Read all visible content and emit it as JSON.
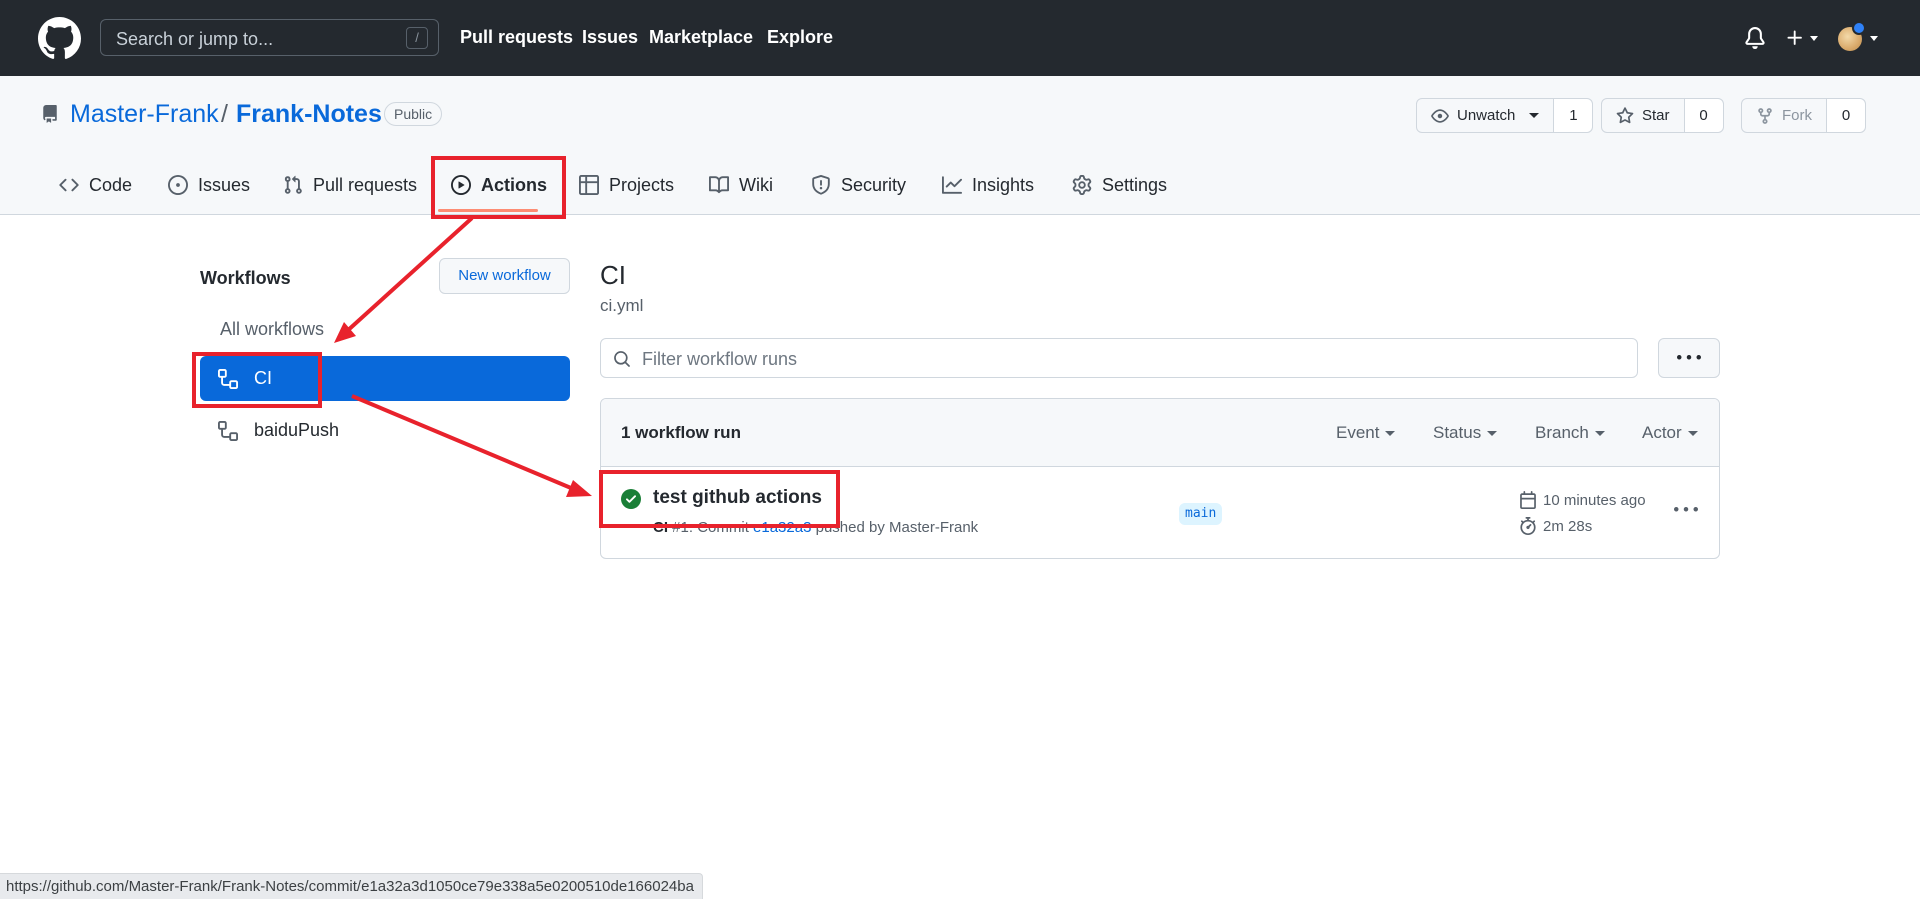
{
  "header": {
    "search_placeholder": "Search or jump to...",
    "search_shortcut": "/",
    "nav": [
      "Pull requests",
      "Issues",
      "Marketplace",
      "Explore"
    ]
  },
  "repo": {
    "owner": "Master-Frank",
    "separator": "/",
    "name": "Frank-Notes",
    "visibility": "Public",
    "watch_label": "Unwatch",
    "watch_count": "1",
    "star_label": "Star",
    "star_count": "0",
    "fork_label": "Fork",
    "fork_count": "0"
  },
  "tabs": [
    {
      "label": "Code",
      "icon": "code-icon"
    },
    {
      "label": "Issues",
      "icon": "issue-opened-icon"
    },
    {
      "label": "Pull requests",
      "icon": "git-pull-request-icon"
    },
    {
      "label": "Actions",
      "icon": "play-icon",
      "selected": true
    },
    {
      "label": "Projects",
      "icon": "table-icon"
    },
    {
      "label": "Wiki",
      "icon": "book-icon"
    },
    {
      "label": "Security",
      "icon": "shield-icon"
    },
    {
      "label": "Insights",
      "icon": "graph-icon"
    },
    {
      "label": "Settings",
      "icon": "gear-icon"
    }
  ],
  "sidebar": {
    "title": "Workflows",
    "new_workflow_label": "New workflow",
    "all_workflows_label": "All workflows",
    "workflows": [
      {
        "name": "CI",
        "selected": true
      },
      {
        "name": "baiduPush",
        "selected": false
      }
    ]
  },
  "main": {
    "workflow_title": "CI",
    "workflow_file": "ci.yml",
    "filter_placeholder": "Filter workflow runs",
    "runs_count_label": "1 workflow run",
    "filters": [
      "Event",
      "Status",
      "Branch",
      "Actor"
    ],
    "runs": [
      {
        "title": "test github actions",
        "workflow": "CI",
        "run_number": "#1: Commit",
        "commit_sha": "e1a32a3",
        "pushed_by": "pushed by Master-Frank",
        "branch": "main",
        "time_ago": "10 minutes ago",
        "duration": "2m 28s",
        "status": "success"
      }
    ]
  },
  "status_bar": {
    "url": "https://github.com/Master-Frank/Frank-Notes/commit/e1a32a3d1050ce79e338a5e0200510de166024ba"
  },
  "colors": {
    "header_bg": "#24292f",
    "link": "#0969da",
    "selected_bg": "#0969da",
    "annotation": "#e8222c",
    "success": "#1a7f37",
    "tab_underline": "#fd8c73"
  }
}
